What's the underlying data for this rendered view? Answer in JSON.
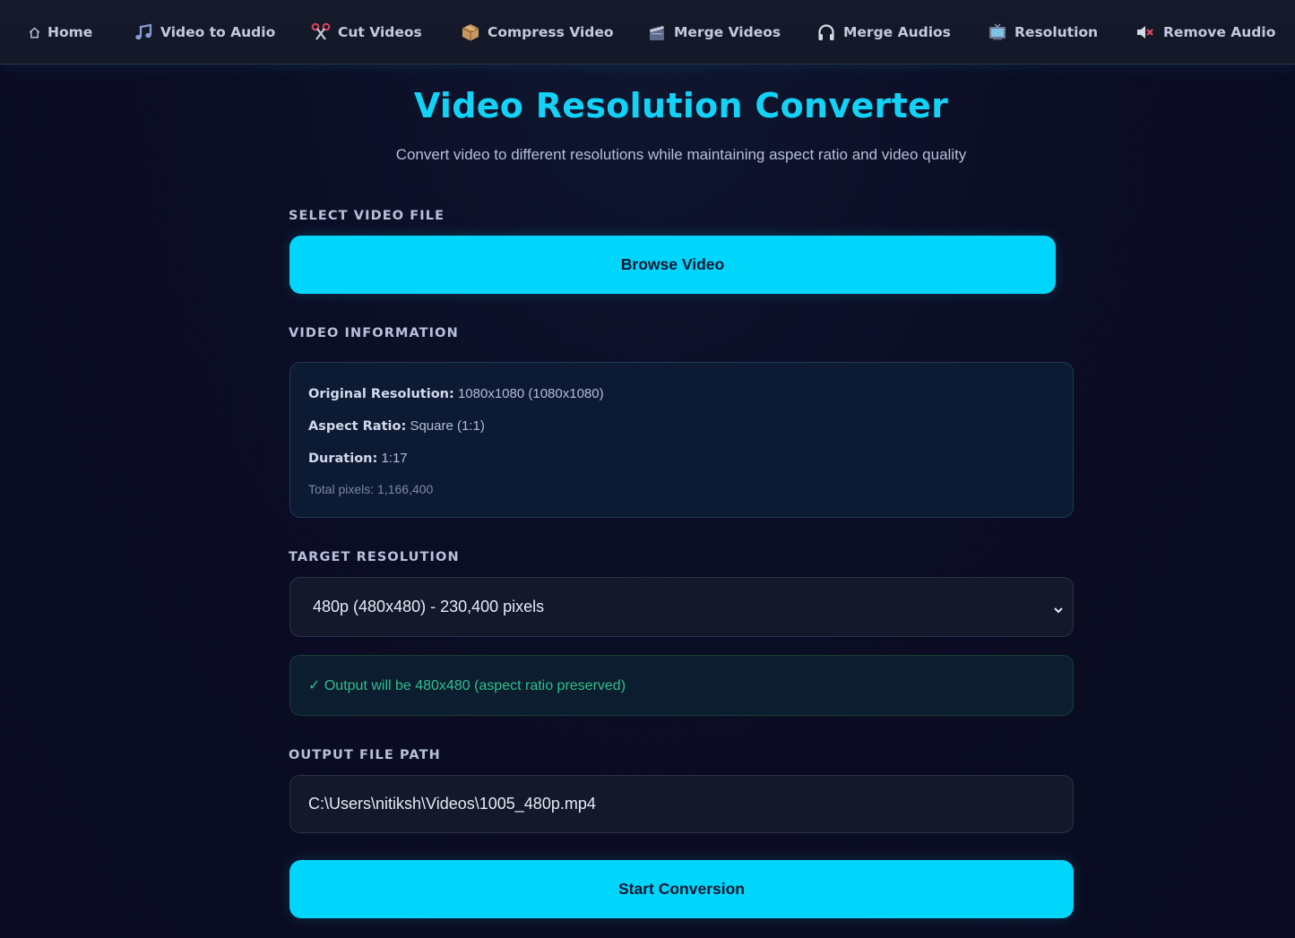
{
  "nav": {
    "items": [
      {
        "label": "Home",
        "icon": "home-icon"
      },
      {
        "label": "Video to Audio",
        "icon": "music-note-icon"
      },
      {
        "label": "Cut Videos",
        "icon": "scissors-icon"
      },
      {
        "label": "Compress Video",
        "icon": "package-icon"
      },
      {
        "label": "Merge Videos",
        "icon": "clapperboard-icon"
      },
      {
        "label": "Merge Audios",
        "icon": "headphones-icon"
      },
      {
        "label": "Resolution",
        "icon": "television-icon"
      },
      {
        "label": "Remove Audio",
        "icon": "muted-speaker-icon"
      }
    ]
  },
  "page": {
    "title": "Video Resolution Converter",
    "subtitle": "Convert video to different resolutions while maintaining aspect ratio and video quality"
  },
  "select_file": {
    "label": "SELECT VIDEO FILE",
    "button": "Browse Video"
  },
  "video_info": {
    "label": "VIDEO INFORMATION",
    "original_resolution_label": "Original Resolution:",
    "original_resolution_value": "1080x1080 (1080x1080)",
    "aspect_ratio_label": "Aspect Ratio:",
    "aspect_ratio_value": "Square (1:1)",
    "duration_label": "Duration:",
    "duration_value": "1:17",
    "total_pixels": "Total pixels: 1,166,400"
  },
  "target": {
    "label": "TARGET RESOLUTION",
    "selected": "480p (480x480) - 230,400 pixels",
    "notice": "✓ Output will be 480x480 (aspect ratio preserved)"
  },
  "output": {
    "label": "OUTPUT FILE PATH",
    "path": "C:\\Users\\nitiksh\\Videos\\1005_480p.mp4"
  },
  "actions": {
    "start": "Start Conversion"
  },
  "colors": {
    "accent": "#00d6fb",
    "background": "#0b0d22",
    "success": "#2fbf8e"
  }
}
